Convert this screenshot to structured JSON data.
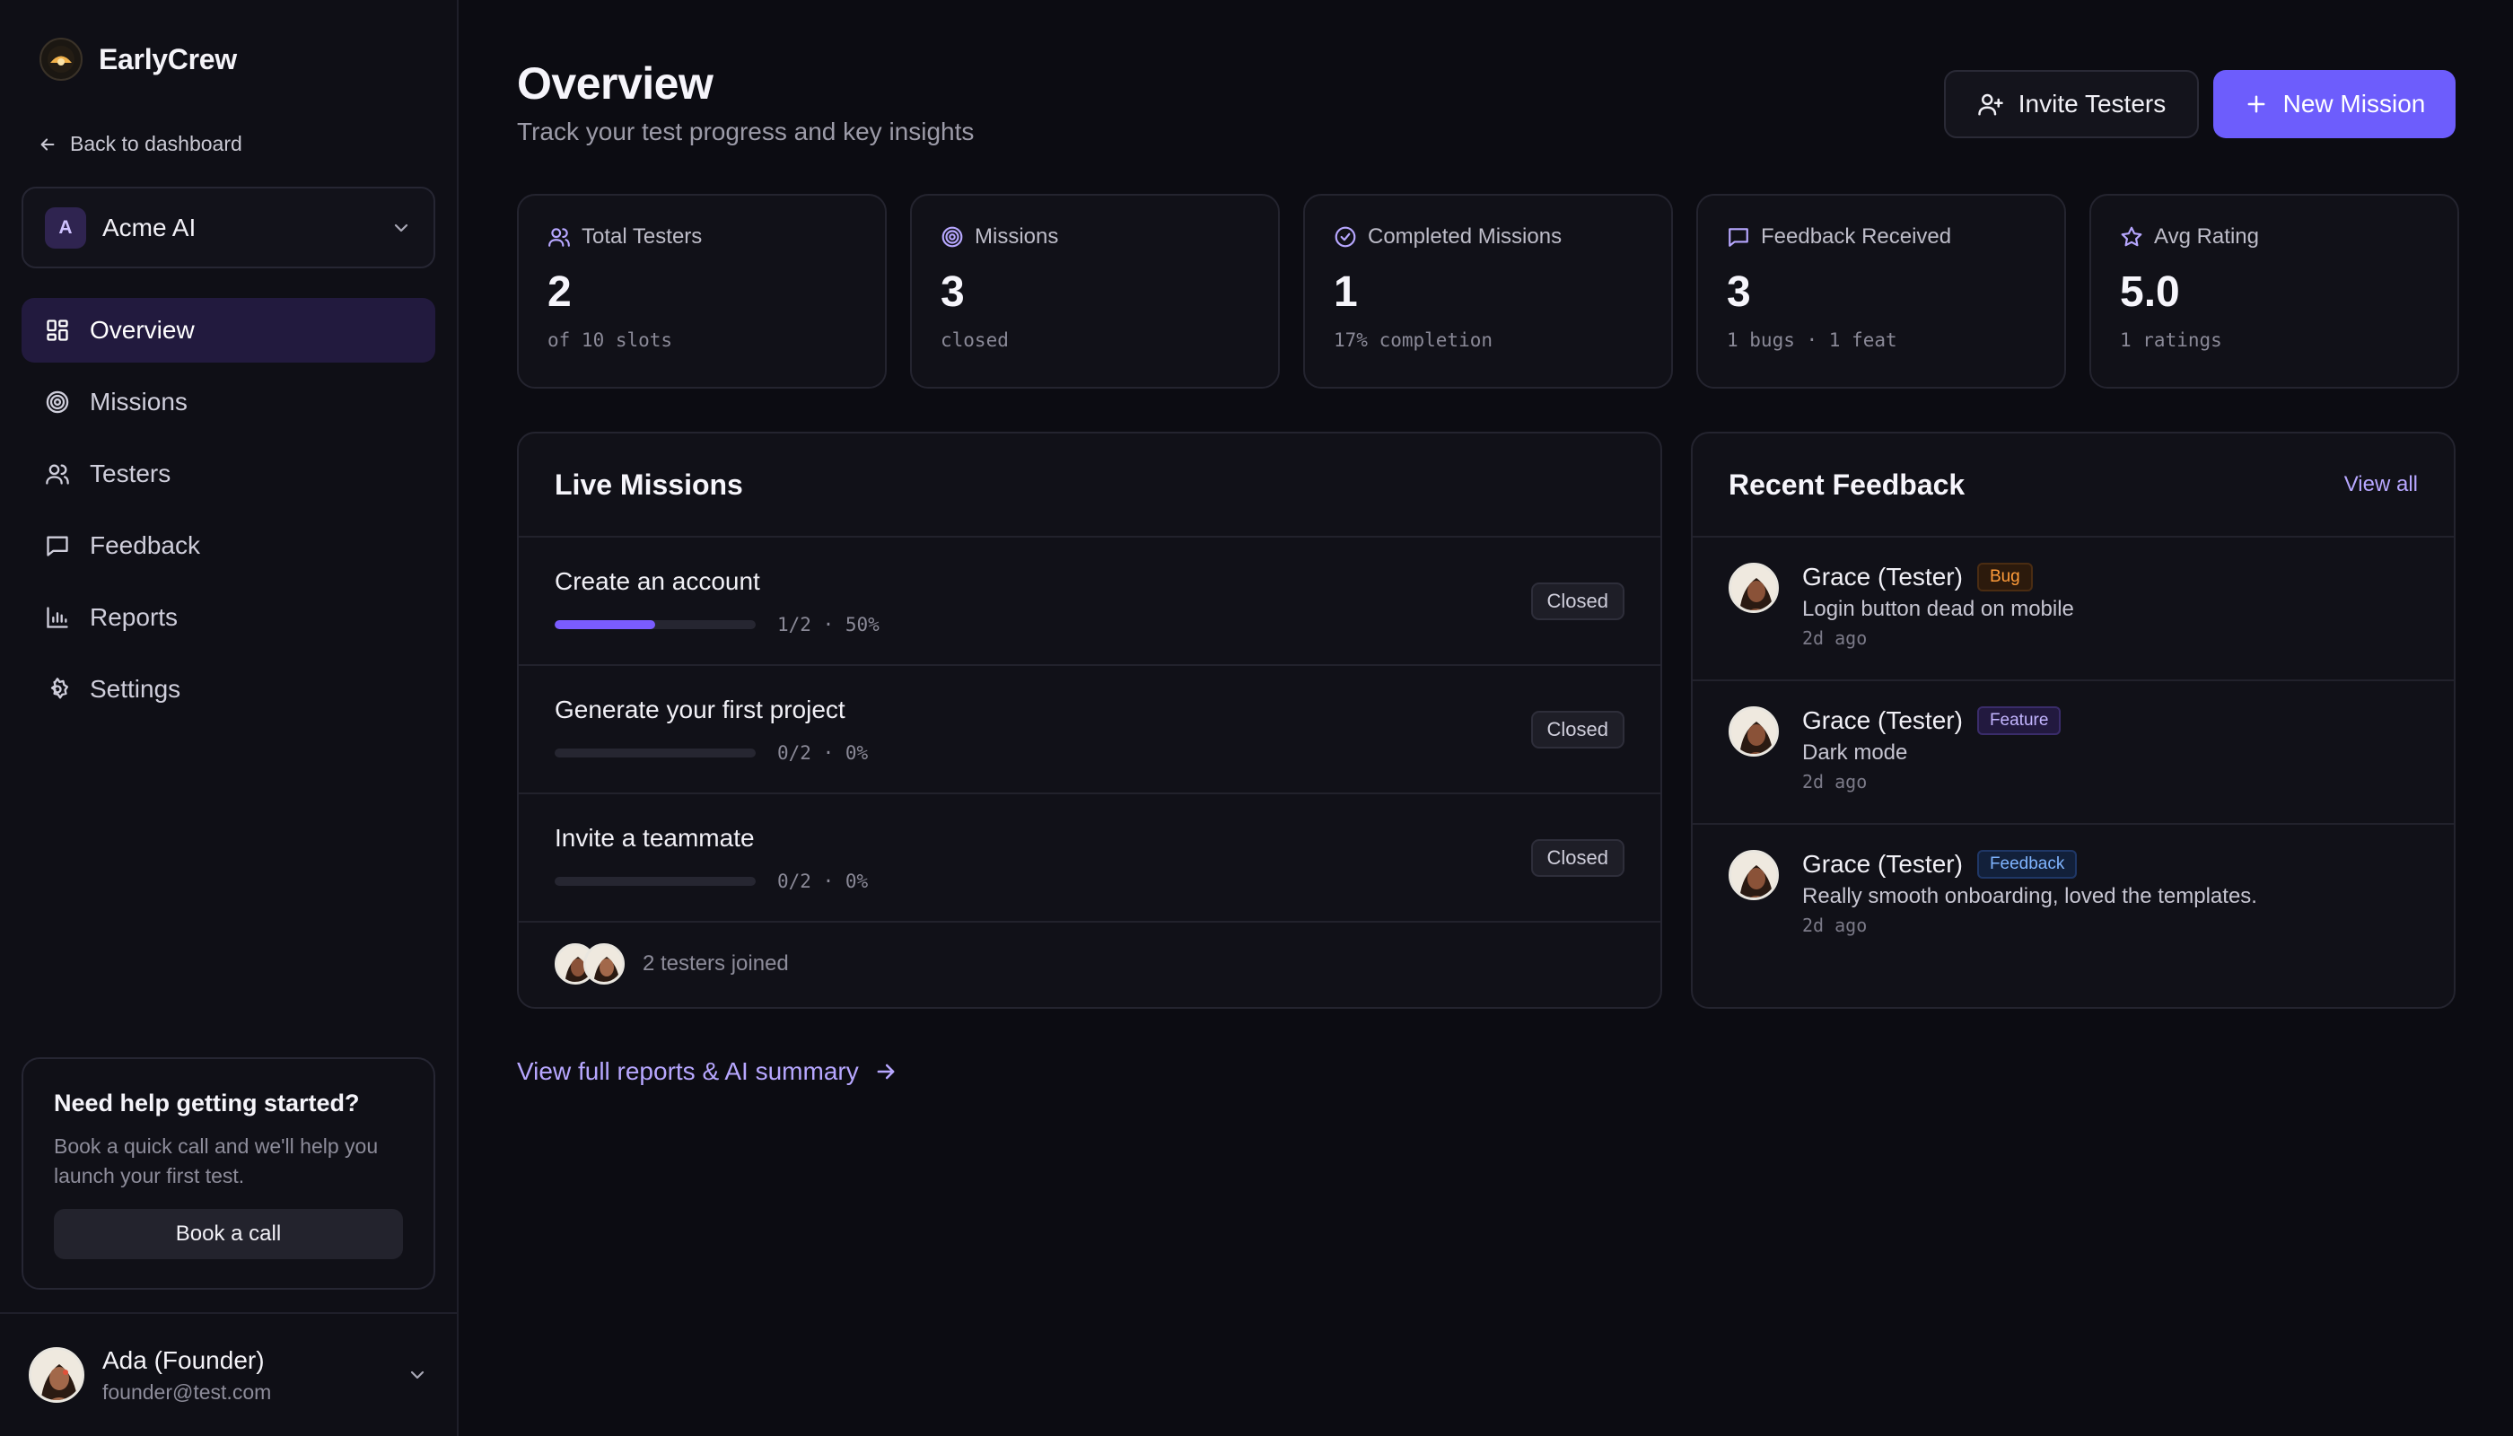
{
  "brand": {
    "name": "EarlyCrew"
  },
  "sidebar": {
    "back_label": "Back to dashboard",
    "workspace": {
      "initial": "A",
      "name": "Acme AI"
    },
    "nav": [
      {
        "label": "Overview",
        "icon": "grid-icon",
        "active": true
      },
      {
        "label": "Missions",
        "icon": "target-icon"
      },
      {
        "label": "Testers",
        "icon": "users-icon"
      },
      {
        "label": "Feedback",
        "icon": "message-icon"
      },
      {
        "label": "Reports",
        "icon": "bar-chart-icon"
      },
      {
        "label": "Settings",
        "icon": "gear-icon"
      }
    ],
    "help": {
      "title": "Need help getting started?",
      "text": "Book a quick call and we'll help you launch your first test.",
      "button": "Book a call"
    },
    "user": {
      "name": "Ada (Founder)",
      "email": "founder@test.com"
    }
  },
  "header": {
    "title": "Overview",
    "subtitle": "Track your test progress and key insights",
    "invite_label": "Invite Testers",
    "new_mission_label": "New Mission"
  },
  "stats": [
    {
      "label": "Total Testers",
      "value": "2",
      "sub": "of 10 slots",
      "icon": "users-icon"
    },
    {
      "label": "Missions",
      "value": "3",
      "sub": "closed",
      "icon": "target-icon"
    },
    {
      "label": "Completed Missions",
      "value": "1",
      "sub": "17% completion",
      "icon": "check-circle-icon"
    },
    {
      "label": "Feedback Received",
      "value": "3",
      "sub": "1 bugs · 1 feat",
      "icon": "message-icon"
    },
    {
      "label": "Avg Rating",
      "value": "5.0",
      "sub": "1 ratings",
      "icon": "star-icon"
    }
  ],
  "live_missions": {
    "title": "Live Missions",
    "items": [
      {
        "name": "Create an account",
        "progress": "1/2 · 50%",
        "fraction": 0.5,
        "status": "Closed"
      },
      {
        "name": "Generate your first project",
        "progress": "0/2 · 0%",
        "fraction": 0,
        "status": "Closed"
      },
      {
        "name": "Invite a teammate",
        "progress": "0/2 · 0%",
        "fraction": 0,
        "status": "Closed"
      }
    ],
    "joined_label": "2 testers joined"
  },
  "recent_feedback": {
    "title": "Recent Feedback",
    "view_all": "View all",
    "items": [
      {
        "name": "Grace (Tester)",
        "tag": "Bug",
        "message": "Login button dead on mobile",
        "time": "2d ago"
      },
      {
        "name": "Grace (Tester)",
        "tag": "Feature",
        "message": "Dark mode",
        "time": "2d ago"
      },
      {
        "name": "Grace (Tester)",
        "tag": "Feedback",
        "message": "Really smooth onboarding, loved the templates.",
        "time": "2d ago"
      }
    ]
  },
  "footer_link": "View full reports & AI summary",
  "colors": {
    "accent": "#6d5dfc",
    "background": "#0c0c12",
    "bug": "#ff9c3a",
    "feature": "#c3b5ff",
    "feedback": "#7fb4ff"
  }
}
